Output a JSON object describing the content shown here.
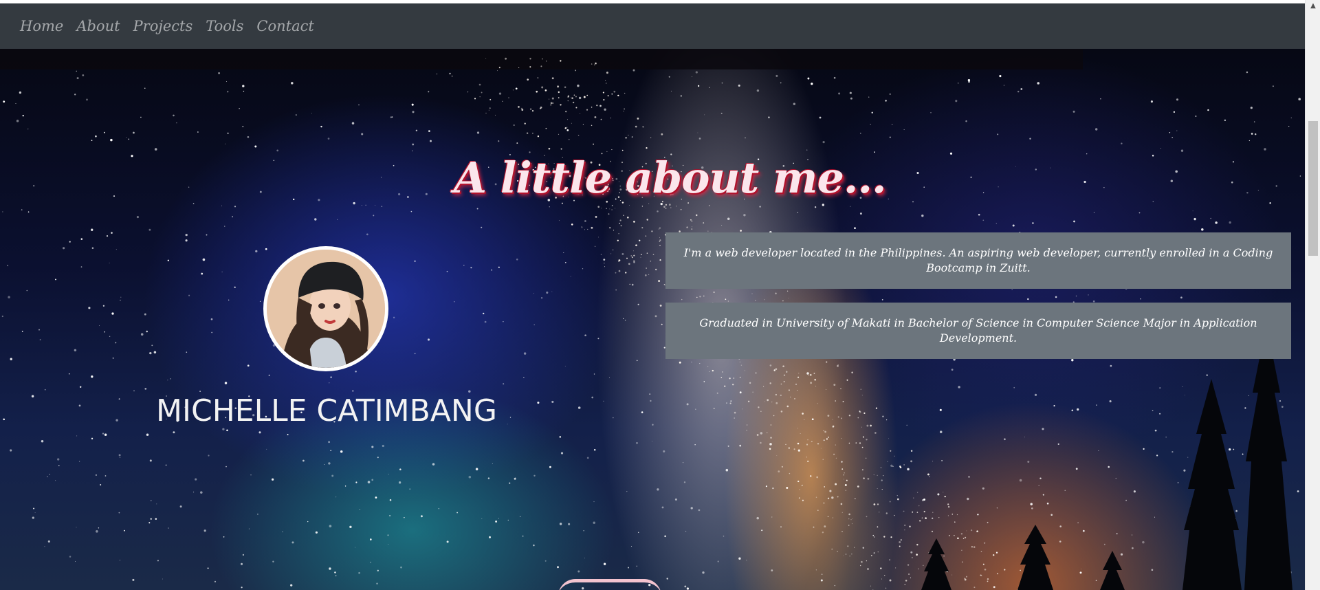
{
  "navbar": {
    "links": [
      "Home",
      "About",
      "Projects",
      "Tools",
      "Contact"
    ]
  },
  "about": {
    "heading": "A little about me...",
    "name": "MICHELLE CATIMBANG",
    "paragraphs": [
      "I'm a web developer located in the Philippines. An aspiring web developer, currently enrolled in a Coding Bootcamp in Zuitt.",
      "Graduated in University of Makati in Bachelor of Science in Computer Science Major in Application Development."
    ]
  },
  "scrollbar": {
    "up_arrow": "▲"
  },
  "colors": {
    "navbar_bg": "#343a40",
    "info_box_bg": "#6c757d",
    "heading_shadow": "#b0122c"
  }
}
